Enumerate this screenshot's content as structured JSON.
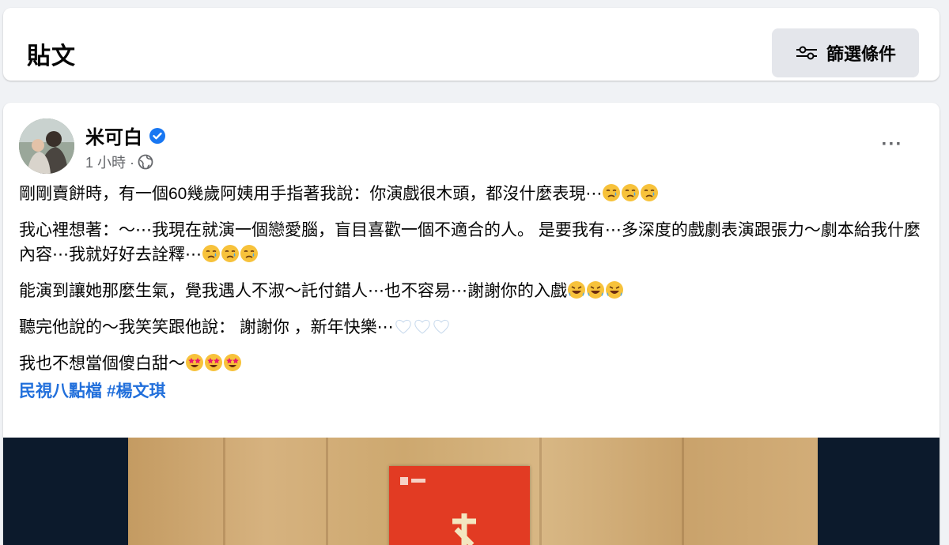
{
  "header": {
    "title": "貼文",
    "filter_label": "篩選條件"
  },
  "post": {
    "author": "米可白",
    "time": "1 小時 ·",
    "paragraphs": [
      "剛剛賣餅時，有一個60幾歲阿姨用手指著我說：你演戲很木頭，都沒什麼表現⋯",
      "我心裡想著：～⋯我現在就演一個戀愛腦，盲目喜歡一個不適合的人。 是要我有⋯多深度的戲劇表演跟張力～劇本給我什麼內容⋯我就好好去詮釋⋯",
      "能演到讓她那麼生氣，覺我遇人不淑～託付錯人⋯也不容易⋯謝謝你的入戲",
      "聽完他說的～我笑笑跟他說： 謝謝你 ，新年快樂⋯",
      "我也不想當個傻白甜～"
    ],
    "hashtags": [
      "民視八點檔",
      "#楊文琪"
    ],
    "emojis": [
      "crying-face",
      "rolling-laughing-face",
      "white-heart",
      "star-struck-face"
    ]
  },
  "colors": {
    "page_bg": "#f0f2f5",
    "link": "#216fdb",
    "verified": "#1877f2",
    "envelope_red": "#e23b23"
  }
}
